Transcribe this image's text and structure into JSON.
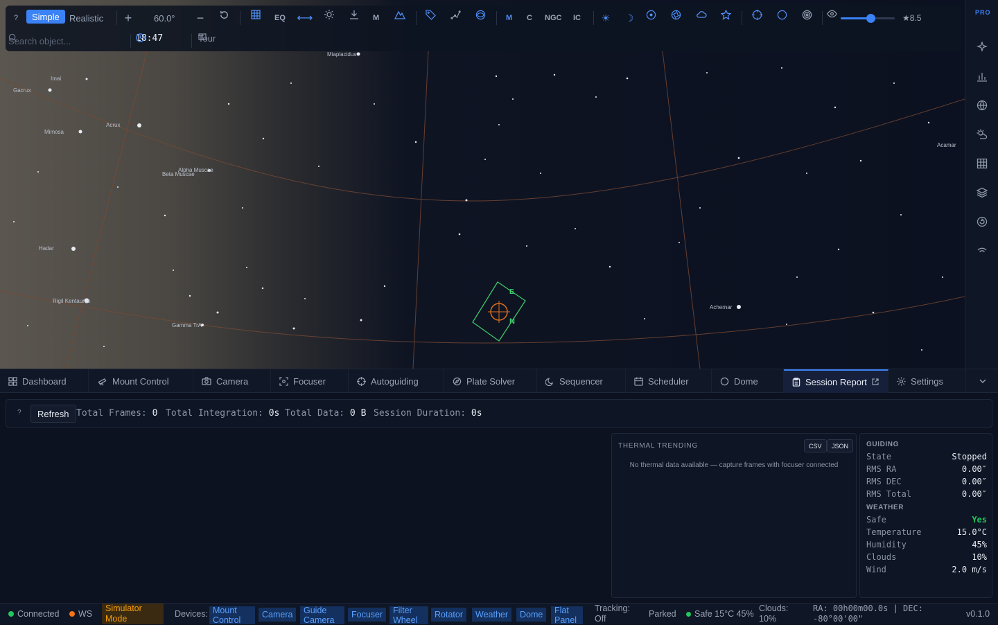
{
  "toolbar": {
    "help_label": "?",
    "mode_simple": "Simple",
    "mode_realistic": "Realistic",
    "fov_value": "60.0°",
    "eq_label": "EQ",
    "m_label": "M",
    "catalog_m": "M",
    "catalog_c": "C",
    "catalog_ngc": "NGC",
    "catalog_ic": "IC",
    "magnitude_label": "★8.5",
    "magnitude_level": 0.55,
    "search_placeholder": "Search object...",
    "time": "18:47",
    "tour_label": "Tour",
    "accent": "#3b82f6"
  },
  "sky": {
    "labels": {
      "miaplacidus": "Miaplacidus",
      "imai": "Imai",
      "gacrux": "Gacrux",
      "acrux": "Acrux",
      "mimosa": "Mimosa",
      "alpha_muscae": "Alpha Muscae",
      "beta_muscae": "Beta Muscae",
      "hadar": "Hadar",
      "rigil": "Rigil Kentaurus",
      "gamma_tra": "Gamma TrA",
      "achernar": "Achernar",
      "acamar": "Acamar"
    },
    "fov_frame": {
      "east_label": "E",
      "north_label": "N",
      "color": "#3fcf6c"
    }
  },
  "rail": {
    "pro_label": "PRO"
  },
  "tabs": [
    {
      "label": "Dashboard",
      "icon": "grid-icon"
    },
    {
      "label": "Mount Control",
      "icon": "telescope-icon"
    },
    {
      "label": "Camera",
      "icon": "camera-icon"
    },
    {
      "label": "Focuser",
      "icon": "focus-icon"
    },
    {
      "label": "Autoguiding",
      "icon": "crosshair-icon"
    },
    {
      "label": "Plate Solver",
      "icon": "compass-icon"
    },
    {
      "label": "Sequencer",
      "icon": "moon-icon"
    },
    {
      "label": "Scheduler",
      "icon": "calendar-icon"
    },
    {
      "label": "Dome",
      "icon": "circle-icon"
    },
    {
      "label": "Session Report",
      "icon": "clipboard-icon",
      "active": true
    },
    {
      "label": "Settings",
      "icon": "gear-icon"
    }
  ],
  "report": {
    "help_label": "?",
    "refresh_label": "Refresh",
    "total_frames_label": "Total Frames:",
    "total_frames_value": "0",
    "total_integration_label": "Total Integration:",
    "total_integration_value": "0s",
    "total_data_label": "Total Data:",
    "total_data_value": "0 B",
    "session_duration_label": "Session Duration:",
    "session_duration_value": "0s",
    "thermal": {
      "title": "THERMAL TRENDING",
      "csv_label": "CSV",
      "json_label": "JSON",
      "empty_message": "No thermal data available — capture frames with focuser connected"
    },
    "guiding": {
      "title": "GUIDING",
      "rows": [
        {
          "key": "State",
          "value": "Stopped"
        },
        {
          "key": "RMS RA",
          "value": "0.00″"
        },
        {
          "key": "RMS DEC",
          "value": "0.00″"
        },
        {
          "key": "RMS Total",
          "value": "0.00″"
        }
      ]
    },
    "weather": {
      "title": "WEATHER",
      "rows": [
        {
          "key": "Safe",
          "value": "Yes"
        },
        {
          "key": "Temperature",
          "value": "15.0°C"
        },
        {
          "key": "Humidity",
          "value": "45%"
        },
        {
          "key": "Clouds",
          "value": "10%"
        },
        {
          "key": "Wind",
          "value": "2.0 m/s"
        }
      ]
    }
  },
  "status": {
    "connected": "Connected",
    "ws": "WS",
    "simulator": "Simulator Mode",
    "devices_label": "Devices:",
    "devices": [
      "Mount Control",
      "Camera",
      "Guide Camera",
      "Focuser",
      "Filter Wheel",
      "Rotator",
      "Weather",
      "Dome",
      "Flat Panel"
    ],
    "tracking": "Tracking: Off",
    "parked": "Parked",
    "safe": "Safe 15°C 45%",
    "clouds": "Clouds: 10%",
    "radec": "RA: 00h00m00.0s | DEC: -80°00'00\"",
    "version": "v0.1.0",
    "colors": {
      "connected": "#22c55e",
      "ws": "#f97316",
      "safe": "#22c55e"
    }
  }
}
